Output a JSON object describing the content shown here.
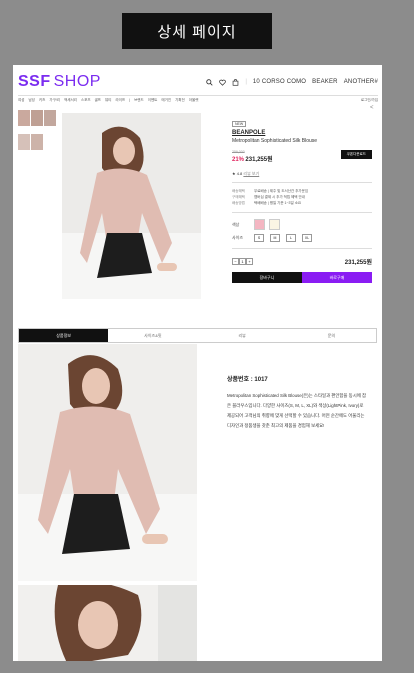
{
  "banner": {
    "title": "상세 페이지"
  },
  "header": {
    "logo_main": "SSF",
    "logo_sub": "SHOP",
    "brands": [
      "10 CORSO COMO",
      "BEAKER",
      "ANOTHER#"
    ]
  },
  "nav": {
    "items": [
      "여성",
      "남성",
      "키즈",
      "가구/리",
      "액세서리",
      "스포츠",
      "골프",
      "뷰티",
      "라이프",
      "|",
      "브랜드",
      "이벤트",
      "매거진",
      "기획전",
      "아울렛"
    ],
    "login": "로그인/가입"
  },
  "product": {
    "tag": "NEW",
    "brand": "BEANPOLE",
    "name": "Metropolitan Sophisticated Silk Blouse",
    "old_price": "259,000",
    "discount": "21%",
    "price": "231,255원",
    "coupon_button": "쿠폰다운로드",
    "rating": "★ 4.8",
    "rating_more": "리뷰 보기",
    "info_rows": [
      {
        "k": "배송혜택",
        "v": "무료배송 | 제주 및 도서산간 추가운임"
      },
      {
        "k": "구매혜택",
        "v": "멤버십 결제 시 추가 적립 혜택 안내"
      },
      {
        "k": "배송방법",
        "v": "택배배송 | 평일 기준 1~3일 소요"
      }
    ],
    "color_label": "색상",
    "colors": [
      "#f4b6c2",
      "#fbf5e4"
    ],
    "size_label": "사이즈",
    "sizes": [
      "S",
      "M",
      "L",
      "XL"
    ],
    "qty": "1",
    "total": "231,255원",
    "cart_button": "장바구니",
    "buy_button": "바로구매"
  },
  "tabs": [
    "상품정보",
    "사이즈&핏",
    "리뷰",
    "문의"
  ],
  "description": {
    "number": "상품번호 : 1017",
    "text": "Metropolitan Sophisticated Silk Blouse(은)는 스타일과 편안함을 동시에 잡은 블라우스입니다. 다양한 사이즈(S, M, L, XL)와 색상(LightPink, Ivory)로 제공되어 고객님의 취향에 맞게 선택할 수 있습니다. 어떤 순간에도 어울리는 디자인과 정품생을 갖춘 최고의 제품을 경험해 보세요!"
  }
}
